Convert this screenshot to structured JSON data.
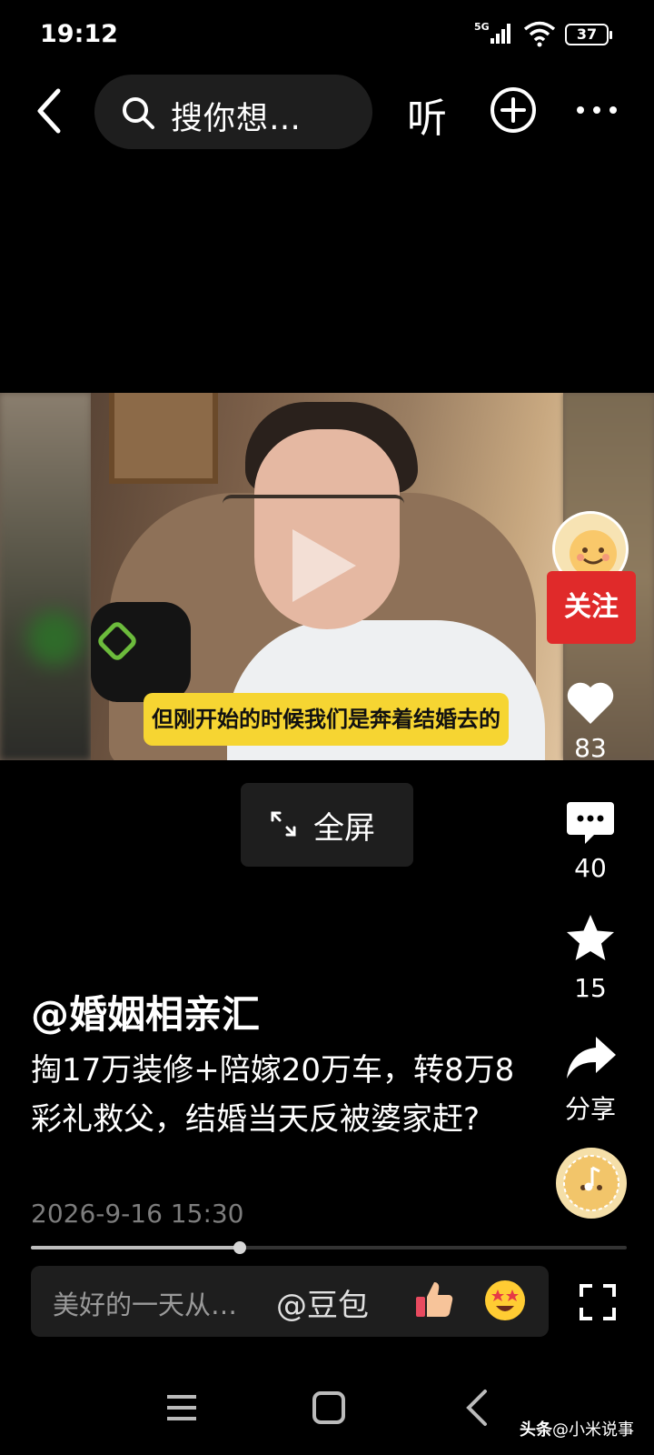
{
  "status_bar": {
    "time": "19:12",
    "network": "5G",
    "battery": "37"
  },
  "top_nav": {
    "search_placeholder": "搜你想…",
    "listen_label": "听",
    "icons": [
      "back-icon",
      "search-icon",
      "plus-circle-icon",
      "more-icon"
    ]
  },
  "video": {
    "subtitle": "但刚开始的时候我们是奔着结婚去的",
    "fullscreen_label": "全屏"
  },
  "side_rail": {
    "follow_label": "关注",
    "like_count": "83",
    "comment_count": "40",
    "favorite_count": "15",
    "share_label": "分享"
  },
  "post": {
    "author": "@婚姻相亲汇",
    "description": "掏17万装修+陪嫁20万车，转8万8彩礼救父，结婚当天反被婆家赶?",
    "date": "2026-9-16 15:30",
    "progress_fraction": 0.35
  },
  "comment_bar": {
    "placeholder": "美好的一天从…",
    "mention": "@豆包"
  },
  "watermark": {
    "brand": "头条",
    "account": "@小米说事"
  },
  "colors": {
    "follow_button": "#e02a2a",
    "subtitle_bg": "#f6d532",
    "panel_bg": "#1e1e1e"
  }
}
